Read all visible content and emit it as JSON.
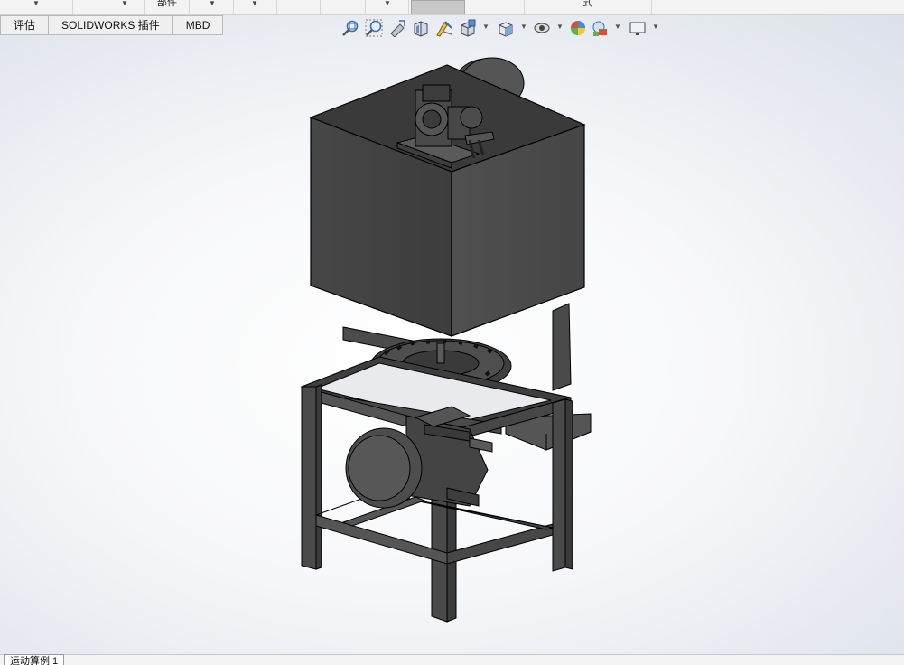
{
  "top_toolbar": {
    "cells": [
      {
        "label": ""
      },
      {
        "label": ""
      },
      {
        "label": "部件"
      },
      {
        "label": ""
      },
      {
        "label": ""
      },
      {
        "label": ""
      },
      {
        "label": ""
      },
      {
        "label": ""
      },
      {
        "label": "式"
      }
    ]
  },
  "tabs": [
    {
      "label": "评估"
    },
    {
      "label": "SOLIDWORKS 插件"
    },
    {
      "label": "MBD"
    }
  ],
  "hud_icons": [
    "zoom-to-fit-icon",
    "zoom-to-area-icon",
    "previous-view-icon",
    "section-view-icon",
    "dynamic-annotation-icon",
    "view-orientation-icon",
    "display-style-icon",
    "hide-show-items-icon",
    "edit-appearance-icon",
    "apply-scene-icon",
    "view-settings-icon"
  ],
  "bottom_tab": {
    "label": "运动算例 1"
  },
  "colors": {
    "model_fill": "#4a4a4a",
    "model_dark": "#333333",
    "model_light": "#5a5a5a",
    "edge": "#000000"
  }
}
